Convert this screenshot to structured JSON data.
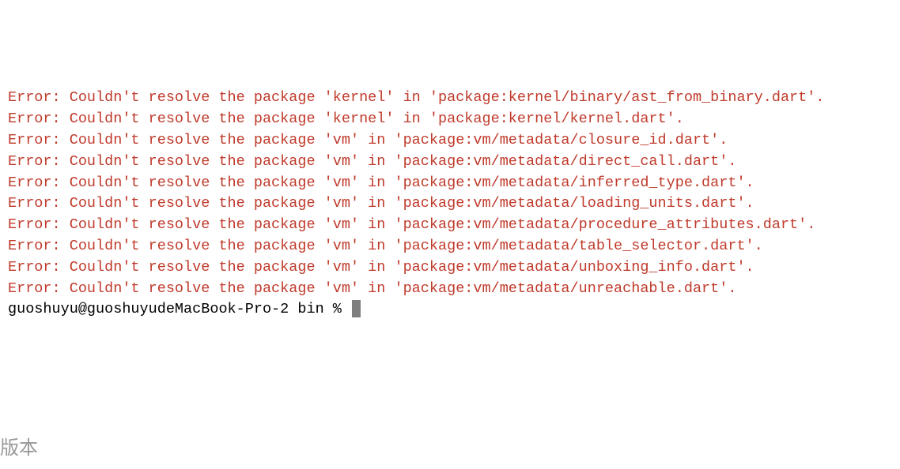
{
  "terminal": {
    "errors": [
      "Error: Couldn't resolve the package 'kernel' in 'package:kernel/binary/ast_from_binary.dart'.",
      "Error: Couldn't resolve the package 'kernel' in 'package:kernel/kernel.dart'.",
      "Error: Couldn't resolve the package 'vm' in 'package:vm/metadata/closure_id.dart'.",
      "Error: Couldn't resolve the package 'vm' in 'package:vm/metadata/direct_call.dart'.",
      "Error: Couldn't resolve the package 'vm' in 'package:vm/metadata/inferred_type.dart'.",
      "Error: Couldn't resolve the package 'vm' in 'package:vm/metadata/loading_units.dart'.",
      "Error: Couldn't resolve the package 'vm' in 'package:vm/metadata/procedure_attributes.dart'.",
      "Error: Couldn't resolve the package 'vm' in 'package:vm/metadata/table_selector.dart'.",
      "Error: Couldn't resolve the package 'vm' in 'package:vm/metadata/unboxing_info.dart'.",
      "Error: Couldn't resolve the package 'vm' in 'package:vm/metadata/unreachable.dart'."
    ],
    "prompt": "guoshuyu@guoshuyudeMacBook-Pro-2 bin % ",
    "background_text": "版本"
  }
}
